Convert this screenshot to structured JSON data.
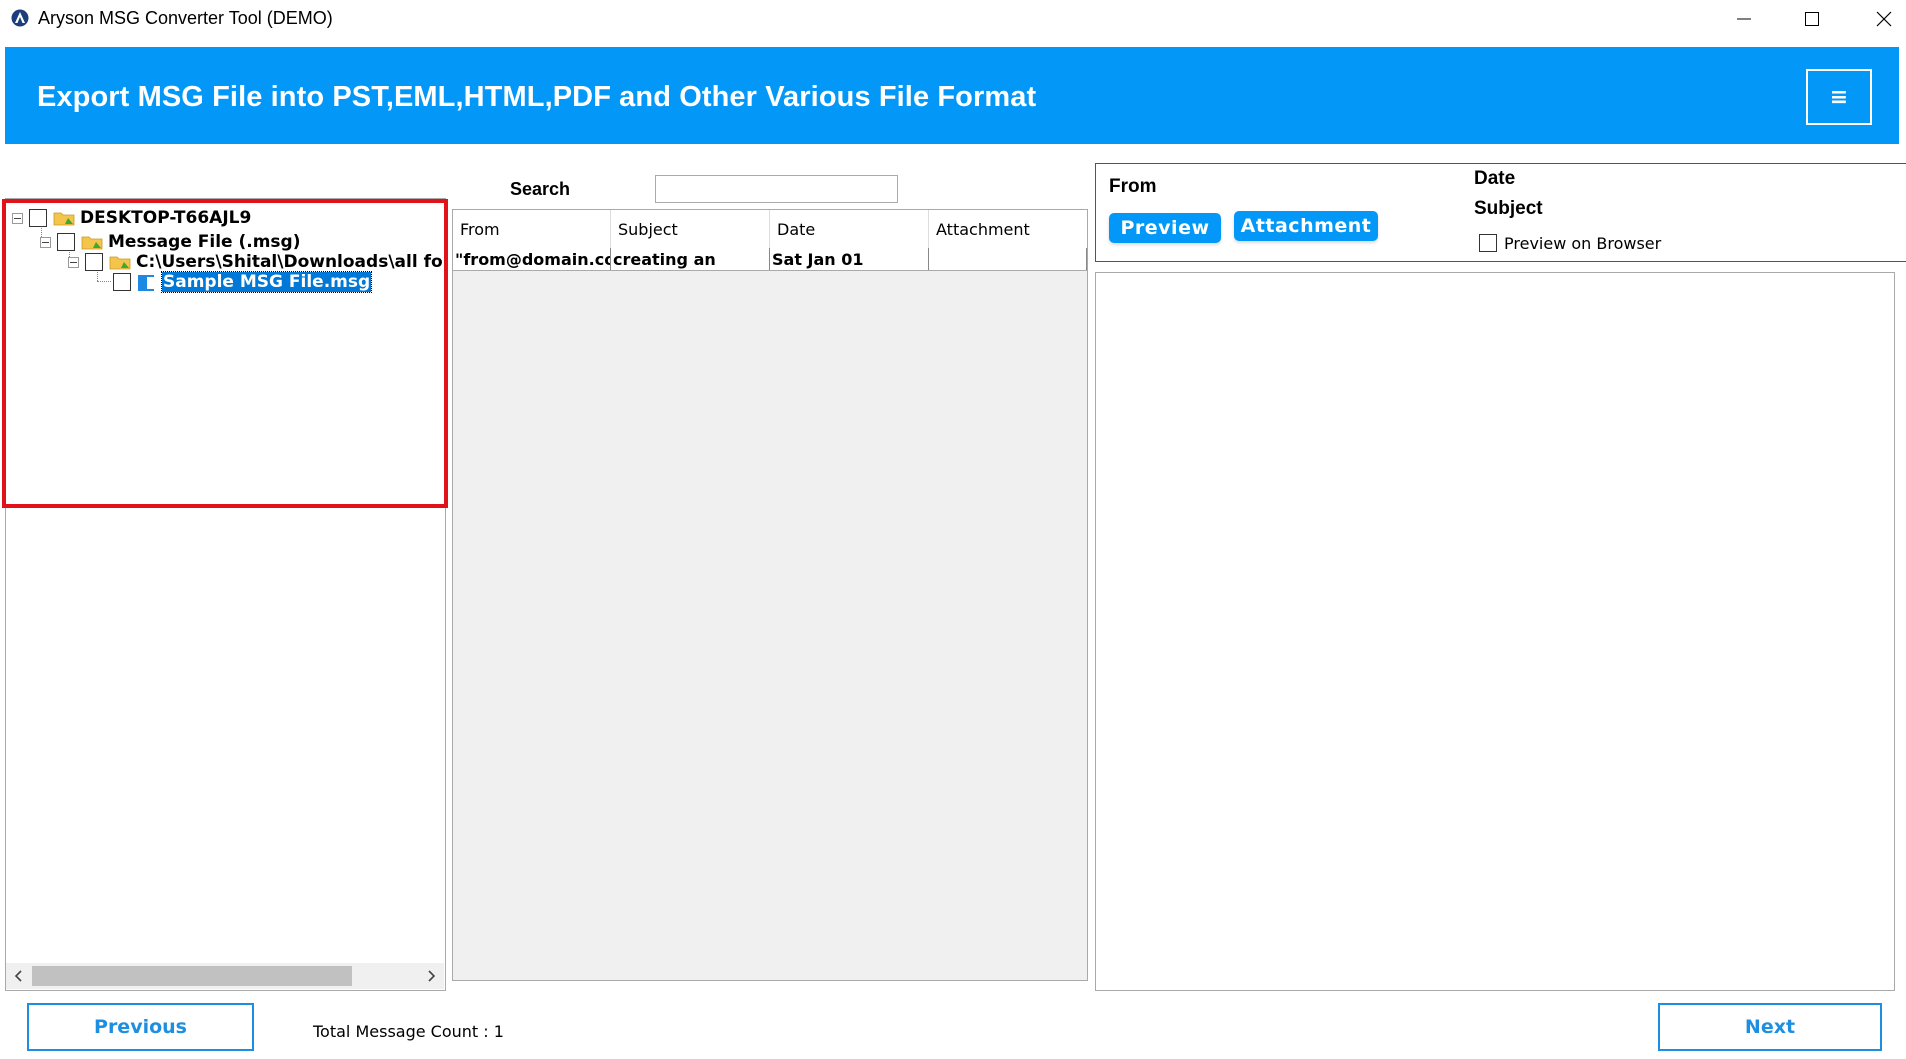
{
  "window": {
    "title": "Aryson MSG Converter Tool (DEMO)",
    "minimize_icon": "minimize-icon",
    "maximize_icon": "maximize-icon",
    "close_icon": "close-icon"
  },
  "header": {
    "title": "Export MSG File into PST,EML,HTML,PDF and Other Various File Format",
    "menu_icon": "≡",
    "accent_color": "#0398F7"
  },
  "tree": {
    "nodes": [
      {
        "label": "DESKTOP-T66AJL9",
        "icon": "folder-icon",
        "checked": false,
        "expanded": true
      },
      {
        "label": "Message File (.msg)",
        "icon": "folder-icon",
        "checked": false,
        "expanded": true
      },
      {
        "label": "C:\\Users\\Shital\\Downloads\\all fo",
        "icon": "folder-icon",
        "checked": false,
        "expanded": true
      },
      {
        "label": "Sample MSG File.msg",
        "icon": "file-icon",
        "checked": false,
        "selected": true
      }
    ],
    "highlight_color": "#E0131A"
  },
  "search": {
    "label": "Search",
    "value": ""
  },
  "grid": {
    "columns": [
      "From",
      "Subject",
      "Date",
      "Attachment"
    ],
    "rows": [
      {
        "from": "\"from@domain.co",
        "subject": "creating an",
        "date": "Sat Jan 01",
        "attachment": ""
      }
    ]
  },
  "preview": {
    "from_label": "From",
    "date_label": "Date",
    "subject_label": "Subject",
    "preview_button": "Preview",
    "attachment_button": "Attachment",
    "browser_checkbox_label": "Preview on Browser",
    "browser_checked": false
  },
  "footer": {
    "previous_button": "Previous",
    "next_button": "Next",
    "total_count_text": "Total Message Count : 1"
  }
}
